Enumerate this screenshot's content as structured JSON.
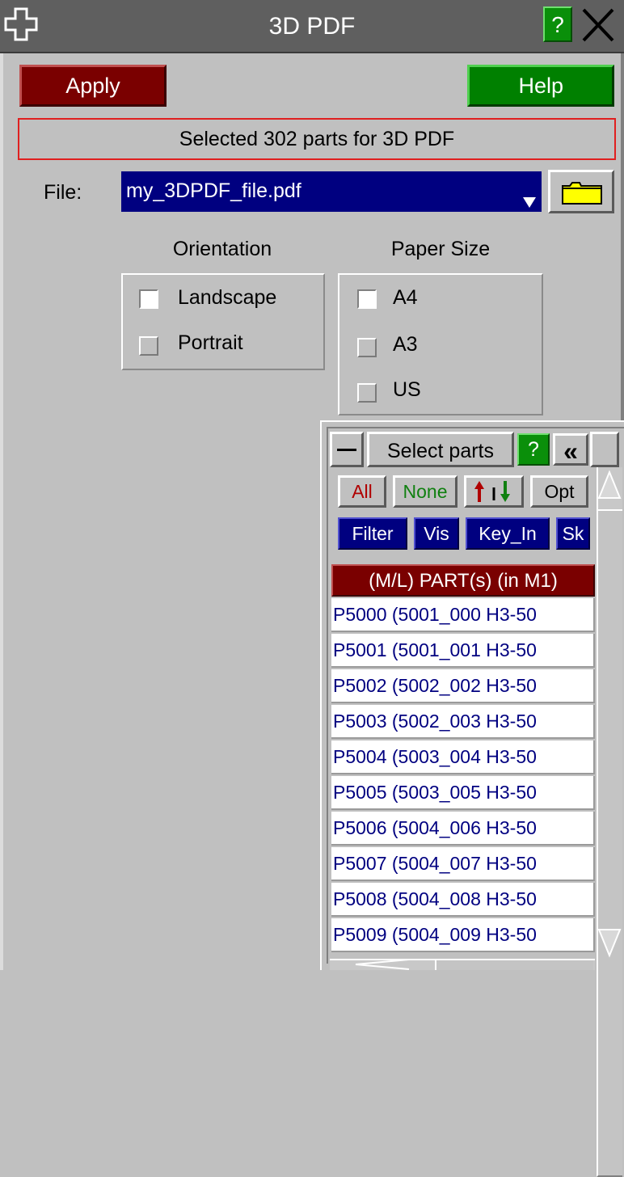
{
  "window": {
    "title": "3D PDF",
    "help_label": "?"
  },
  "toolbar": {
    "apply_label": "Apply",
    "help_label": "Help"
  },
  "status": {
    "message": "Selected 302 parts for 3D PDF"
  },
  "file": {
    "label": "File:",
    "value": "my_3DPDF_file.pdf"
  },
  "orientation": {
    "heading": "Orientation",
    "options": [
      {
        "label": "Landscape",
        "selected": true
      },
      {
        "label": "Portrait",
        "selected": false
      }
    ]
  },
  "paper_size": {
    "heading": "Paper Size",
    "options": [
      {
        "label": "A4",
        "selected": true
      },
      {
        "label": "A3",
        "selected": false
      },
      {
        "label": "US",
        "selected": false
      }
    ]
  },
  "select_parts": {
    "title": "Select parts",
    "help_label": "?",
    "collapse_label": "«",
    "buttons": {
      "all": "All",
      "none": "None",
      "opt": "Opt",
      "filter": "Filter",
      "vis": "Vis",
      "key_in": "Key_In",
      "sk": "Sk"
    },
    "list_header": "(M/L) PART(s) (in M1)",
    "items": [
      "P5000 (5001_000 H3-50",
      "P5001 (5001_001 H3-50",
      "P5002 (5002_002 H3-50",
      "P5003 (5002_003 H3-50",
      "P5004 (5003_004 H3-50",
      "P5005 (5003_005 H3-50",
      "P5006 (5004_006 H3-50",
      "P5007 (5004_007 H3-50",
      "P5008 (5004_008 H3-50",
      "P5009 (5004_009 H3-50"
    ]
  },
  "colors": {
    "apply": "#7a0000",
    "help": "#008000",
    "file_field": "#000080",
    "list_text": "#000080",
    "status_border": "#e02020"
  },
  "icons": [
    "move-icon",
    "close-icon",
    "dropdown-arrow-icon",
    "folder-icon",
    "collapse-icon",
    "sort-icon"
  ]
}
